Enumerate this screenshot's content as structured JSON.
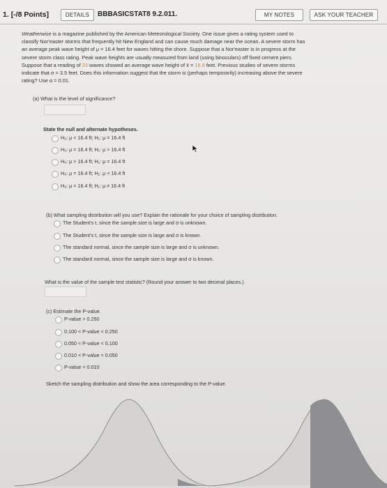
{
  "header": {
    "question_number": "1.",
    "points": "[-/8 Points]",
    "details_button": "DETAILS",
    "problem_code": "BBBASICSTAT8 9.2.011.",
    "my_notes_button": "MY NOTES",
    "ask_teacher_button": "ASK YOUR TEACHER"
  },
  "problem": {
    "line1_a": "Weatherwise",
    "line1_b": " is a magazine published by the American Meteorological Society. One issue gives a rating system used to",
    "line2": "classify Nor'easter storms that frequently hit New England and can cause much damage near the ocean. A severe storm has",
    "line3": "an average peak wave height of μ = 16.4 feet for waves hitting the shore. Suppose that a Nor'easter is in progress at the",
    "line4": "severe storm class rating. Peak wave heights are usually measured from land (using binoculars) off fixed cement piers.",
    "line5_a": "Suppose that a reading of ",
    "line5_n": "33",
    "line5_b": " waves showed an average wave height of x̄ = ",
    "line5_x": "16.9",
    "line5_c": " feet. Previous studies of severe storms",
    "line6": "indicate that σ = 3.5 feet. Does this information suggest that the storm is (perhaps temporarily) increasing above the severe",
    "line7": "rating? Use α = 0.01."
  },
  "part_a": {
    "question": "(a) What is the level of significance?",
    "answer": ""
  },
  "hypotheses": {
    "prompt": "State the null and alternate hypotheses.",
    "options": [
      "H₀: μ < 16.4 ft; H₁: μ = 16.4 ft",
      "H₀: μ = 16.4 ft; H₁: μ > 16.4 ft",
      "H₀: μ > 16.4 ft; H₁: μ = 16.4 ft",
      "H₀: μ = 16.4 ft; H₁: μ < 16.4 ft",
      "H₀: μ = 16.4 ft; H₁: μ ≠ 16.4 ft"
    ]
  },
  "part_b": {
    "question": "(b) What sampling distribution will you use? Explain the rationale for your choice of sampling distribution.",
    "options": [
      "The Student's t, since the sample size is large and σ is unknown.",
      "The Student's t, since the sample size is large and σ is known.",
      "The standard normal, since the sample size is large and σ is unknown.",
      "The standard normal, since the sample size is large and σ is known."
    ],
    "test_stat_question": "What is the value of the sample test statistic? (Round your answer to two decimal places.)",
    "test_stat_answer": ""
  },
  "part_c": {
    "question": "(c) Estimate the P-value.",
    "options": [
      "P-value > 0.250",
      "0.100 < P-value < 0.250",
      "0.050 < P-value < 0.100",
      "0.010 < P-value < 0.050",
      "P-value < 0.010"
    ],
    "sketch_prompt": "Sketch the sampling distribution and show the area corresponding to the P-value."
  },
  "colors": {
    "highlight": "#d9822b",
    "shade": "#8e8e93"
  }
}
